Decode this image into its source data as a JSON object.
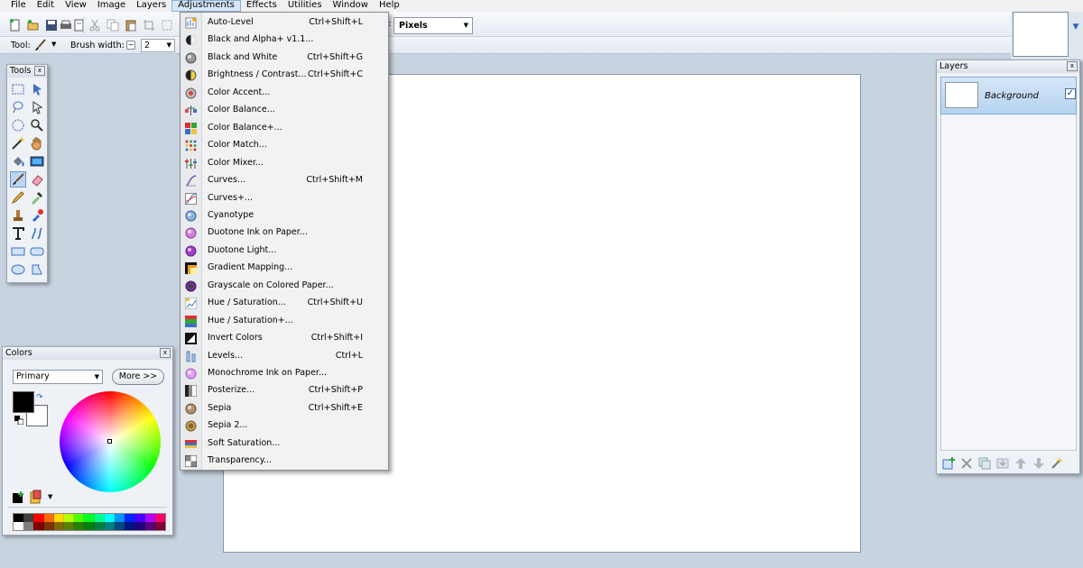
{
  "menubar": {
    "items": [
      "File",
      "Edit",
      "View",
      "Image",
      "Layers",
      "Adjustments",
      "Effects",
      "Utilities",
      "Window",
      "Help"
    ],
    "active": "Adjustments"
  },
  "toolbar": {
    "tool_label": "Tool:",
    "brush_width_label": "Brush width:",
    "brush_width_value": "2",
    "units_label": ":",
    "units_value": "Pixels"
  },
  "tools_window": {
    "title": "Tools"
  },
  "colors_window": {
    "title": "Colors",
    "primary_select": "Primary",
    "more_button": "More >>",
    "primary_color": "#000000",
    "secondary_color": "#ffffff"
  },
  "layers_window": {
    "title": "Layers",
    "layers": [
      {
        "name": "Background",
        "visible": true
      }
    ]
  },
  "adjustments_menu": {
    "items": [
      {
        "label": "Auto-Level",
        "shortcut": "Ctrl+Shift+L",
        "icon": "auto-level-icon"
      },
      {
        "label": "Black and Alpha+ v1.1...",
        "shortcut": "",
        "icon": "black-alpha-icon"
      },
      {
        "label": "Black and White",
        "shortcut": "Ctrl+Shift+G",
        "icon": "black-white-icon"
      },
      {
        "label": "Brightness / Contrast...",
        "shortcut": "Ctrl+Shift+C",
        "icon": "brightness-icon"
      },
      {
        "label": "Color Accent...",
        "shortcut": "",
        "icon": "color-accent-icon"
      },
      {
        "label": "Color Balance...",
        "shortcut": "",
        "icon": "color-balance-icon"
      },
      {
        "label": "Color Balance+...",
        "shortcut": "",
        "icon": "color-balance-plus-icon"
      },
      {
        "label": "Color Match...",
        "shortcut": "",
        "icon": "color-match-icon"
      },
      {
        "label": "Color Mixer...",
        "shortcut": "",
        "icon": "color-mixer-icon"
      },
      {
        "label": "Curves...",
        "shortcut": "Ctrl+Shift+M",
        "icon": "curves-icon"
      },
      {
        "label": "Curves+...",
        "shortcut": "",
        "icon": "curves-plus-icon"
      },
      {
        "label": "Cyanotype",
        "shortcut": "",
        "icon": "cyanotype-icon"
      },
      {
        "label": "Duotone Ink on Paper...",
        "shortcut": "",
        "icon": "duotone-ink-icon"
      },
      {
        "label": "Duotone Light...",
        "shortcut": "",
        "icon": "duotone-light-icon"
      },
      {
        "label": "Gradient Mapping...",
        "shortcut": "",
        "icon": "gradient-mapping-icon"
      },
      {
        "label": "Grayscale on Colored Paper...",
        "shortcut": "",
        "icon": "grayscale-paper-icon"
      },
      {
        "label": "Hue / Saturation...",
        "shortcut": "Ctrl+Shift+U",
        "icon": "hue-saturation-icon"
      },
      {
        "label": "Hue / Saturation+...",
        "shortcut": "",
        "icon": "hue-saturation-plus-icon"
      },
      {
        "label": "Invert Colors",
        "shortcut": "Ctrl+Shift+I",
        "icon": "invert-colors-icon"
      },
      {
        "label": "Levels...",
        "shortcut": "Ctrl+L",
        "icon": "levels-icon"
      },
      {
        "label": "Monochrome Ink on Paper...",
        "shortcut": "",
        "icon": "monochrome-ink-icon"
      },
      {
        "label": "Posterize...",
        "shortcut": "Ctrl+Shift+P",
        "icon": "posterize-icon"
      },
      {
        "label": "Sepia",
        "shortcut": "Ctrl+Shift+E",
        "icon": "sepia-icon"
      },
      {
        "label": "Sepia 2...",
        "shortcut": "",
        "icon": "sepia-2-icon"
      },
      {
        "label": "Soft Saturation...",
        "shortcut": "",
        "icon": "soft-saturation-icon"
      },
      {
        "label": "Transparency...",
        "shortcut": "",
        "icon": "transparency-icon"
      }
    ]
  },
  "palette": [
    "#000000",
    "#404040",
    "#ff0000",
    "#ff6a00",
    "#ffd800",
    "#b6ff00",
    "#4cff00",
    "#00ff21",
    "#00ff90",
    "#00ffff",
    "#0094ff",
    "#0026ff",
    "#4800ff",
    "#b200ff",
    "#ff006e",
    "#ffffff",
    "#808080",
    "#7f0000",
    "#7f3300",
    "#7f6a00",
    "#5b7f00",
    "#267f00",
    "#007f0e",
    "#007f46",
    "#007f7f",
    "#004a7f",
    "#00137f",
    "#21007f",
    "#57007f",
    "#7f0037"
  ]
}
